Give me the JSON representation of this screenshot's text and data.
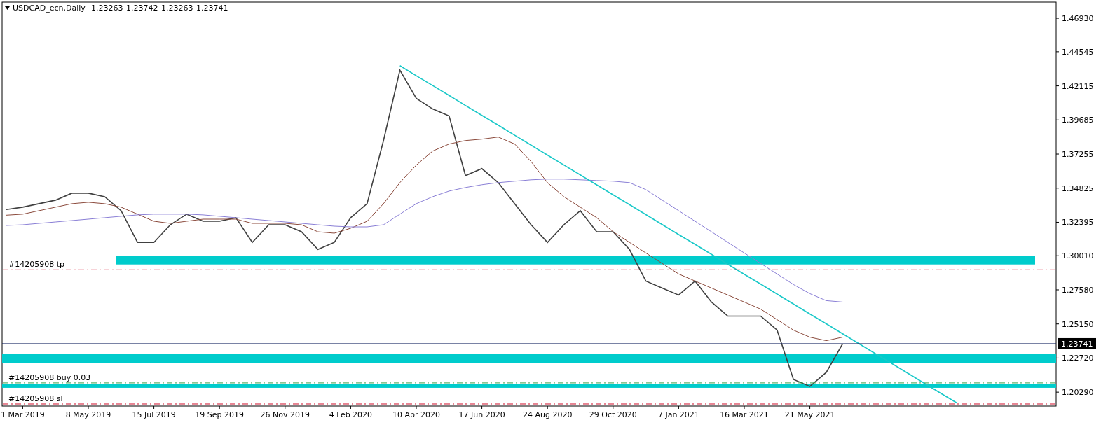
{
  "header": {
    "symbol": "USDCAD_ecn,Daily",
    "ohlc": [
      "1.23263",
      "1.23742",
      "1.23263",
      "1.23741"
    ]
  },
  "chart_data": {
    "type": "line",
    "ylim": [
      1.193,
      1.4808
    ],
    "categories": [
      null,
      "1 Mar 2019",
      null,
      null,
      null,
      "8 May 2019",
      null,
      null,
      null,
      "15 Jul 2019",
      null,
      null,
      null,
      "19 Sep 2019",
      null,
      null,
      null,
      "26 Nov 2019",
      null,
      null,
      null,
      "4 Feb 2020",
      null,
      null,
      null,
      "10 Apr 2020",
      null,
      null,
      null,
      "17 Jun 2020",
      null,
      null,
      null,
      "24 Aug 2020",
      null,
      null,
      null,
      "29 Oct 2020",
      null,
      null,
      null,
      "7 Jan 2021",
      null,
      null,
      null,
      "16 Mar 2021",
      null,
      null,
      null,
      "21 May 2021",
      null,
      null,
      null,
      null,
      null,
      null,
      null,
      null,
      null,
      null,
      null,
      null,
      null,
      null
    ],
    "yticks": [
      {
        "value": 1.4693,
        "label": "1.46930"
      },
      {
        "value": 1.44545,
        "label": "1.44545"
      },
      {
        "value": 1.42115,
        "label": "1.42115"
      },
      {
        "value": 1.39685,
        "label": "1.39685"
      },
      {
        "value": 1.37255,
        "label": "1.37255"
      },
      {
        "value": 1.34825,
        "label": "1.34825"
      },
      {
        "value": 1.32395,
        "label": "1.32395"
      },
      {
        "value": 1.3001,
        "label": "1.30010"
      },
      {
        "value": 1.2758,
        "label": "1.27580"
      },
      {
        "value": 1.2515,
        "label": "1.25150"
      },
      {
        "value": 1.2272,
        "label": "1.22720"
      },
      {
        "value": 1.2029,
        "label": "1.20290"
      }
    ],
    "series": [
      {
        "color": "#404040",
        "values": [
          1.333,
          1.3347,
          1.3372,
          1.3397,
          1.3447,
          1.3447,
          1.3422,
          1.3322,
          1.3096,
          1.3096,
          1.3222,
          1.3297,
          1.3247,
          1.3247,
          1.3272,
          1.3096,
          1.3222,
          1.3222,
          1.3172,
          1.3046,
          1.3096,
          1.3272,
          1.3372,
          1.3822,
          1.4323,
          1.4122,
          1.4047,
          1.3997,
          1.3572,
          1.3622,
          1.3522,
          1.3372,
          1.3222,
          1.3096,
          1.3222,
          1.3322,
          1.3172,
          1.3172,
          1.3046,
          1.2821,
          1.2771,
          1.2721,
          1.2821,
          1.2671,
          1.2571,
          1.2571,
          1.2571,
          1.2471,
          1.212,
          1.207,
          1.217,
          1.2374,
          null,
          null,
          null,
          null,
          null,
          null,
          null,
          null,
          null,
          null,
          null,
          null
        ]
      },
      {
        "color": "#8b4a3c",
        "values": [
          1.329,
          1.3297,
          1.3322,
          1.3347,
          1.3372,
          1.3382,
          1.3372,
          1.3347,
          1.3297,
          1.3247,
          1.3232,
          1.3247,
          1.3262,
          1.3262,
          1.3262,
          1.3232,
          1.3232,
          1.3232,
          1.3222,
          1.3172,
          1.3162,
          1.3197,
          1.3247,
          1.3372,
          1.3522,
          1.3647,
          1.3747,
          1.3797,
          1.3822,
          1.3832,
          1.3847,
          1.3797,
          1.3672,
          1.3522,
          1.3422,
          1.3347,
          1.3272,
          1.3172,
          1.3096,
          1.3021,
          1.2946,
          1.2871,
          1.2821,
          1.2771,
          1.2721,
          1.2671,
          1.2621,
          1.2546,
          1.2471,
          1.2421,
          1.2396,
          1.2421,
          null,
          null,
          null,
          null,
          null,
          null,
          null,
          null,
          null,
          null,
          null,
          null
        ]
      },
      {
        "color": "#8a7fd6",
        "values": [
          1.3217,
          1.3222,
          1.3232,
          1.3242,
          1.3252,
          1.3262,
          1.3272,
          1.3282,
          1.3292,
          1.3297,
          1.3297,
          1.3297,
          1.3292,
          1.3282,
          1.3272,
          1.3262,
          1.3252,
          1.3242,
          1.3232,
          1.3222,
          1.3212,
          1.3207,
          1.3207,
          1.3222,
          1.3297,
          1.3372,
          1.3422,
          1.3462,
          1.3487,
          1.3507,
          1.3522,
          1.3532,
          1.3542,
          1.3547,
          1.3547,
          1.3542,
          1.3537,
          1.3532,
          1.3522,
          1.3472,
          1.3397,
          1.3322,
          1.3247,
          1.3172,
          1.3096,
          1.3021,
          1.2946,
          1.2871,
          1.2796,
          1.2731,
          1.2681,
          1.2671,
          null,
          null,
          null,
          null,
          null,
          null,
          null,
          null,
          null,
          null,
          null,
          null
        ]
      },
      {
        "color": "#19c8c8",
        "values": [
          null,
          null,
          null,
          null,
          null,
          null,
          null,
          null,
          null,
          null,
          null,
          null,
          null,
          null,
          null,
          null,
          null,
          null,
          null,
          null,
          null,
          null,
          null,
          null,
          1.4355,
          1.4284,
          1.4214,
          1.4143,
          1.4072,
          1.4001,
          1.3931,
          1.386,
          1.3789,
          1.3718,
          1.3648,
          1.3577,
          1.3506,
          1.3435,
          1.3365,
          1.3294,
          1.3223,
          1.3152,
          1.3082,
          1.3011,
          1.294,
          1.2869,
          1.2799,
          1.2728,
          1.2657,
          1.2586,
          1.2516,
          1.2445,
          1.2374,
          1.2303,
          1.2233,
          1.2162,
          1.2091,
          1.202,
          1.195,
          null,
          null,
          null,
          null,
          null
        ]
      }
    ],
    "ref_lines": [
      {
        "axis": "y",
        "value": 1.2901,
        "label": "#14205908 tp",
        "color": "#d0102c"
      },
      {
        "axis": "y",
        "value": 1.2095,
        "label": "#14205908 buy 0.03",
        "color": "#3aa04a"
      },
      {
        "axis": "y",
        "value": 1.1945,
        "label": "#14205908 sl",
        "color": "#d0102c"
      },
      {
        "axis": "y",
        "value": 1.23741,
        "label": "1.23741",
        "color": "#0a1a5a"
      }
    ],
    "bands": [
      {
        "axis": "y",
        "from": 1.2939,
        "to": 1.3001
      },
      {
        "axis": "y",
        "from": 1.2236,
        "to": 1.2301
      },
      {
        "axis": "y",
        "from": 1.206,
        "to": 1.2085
      }
    ]
  }
}
